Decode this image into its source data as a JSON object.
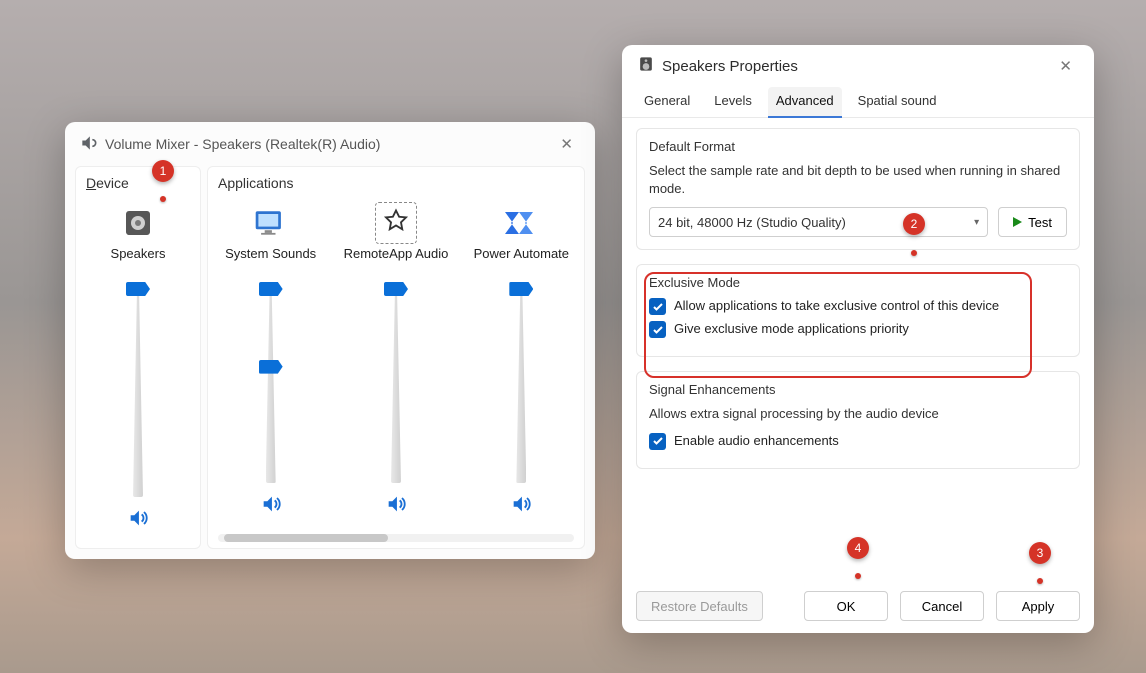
{
  "mixer": {
    "title": "Volume Mixer - Speakers (Realtek(R) Audio)",
    "device_section": "Device",
    "apps_section": "Applications",
    "device": {
      "name": "Speakers",
      "level": 0
    },
    "apps": [
      {
        "name": "System Sounds",
        "level": 40
      },
      {
        "name": "RemoteApp Audio",
        "level": 0
      },
      {
        "name": "Power Automate",
        "level": 0
      }
    ]
  },
  "props": {
    "title": "Speakers Properties",
    "tabs": [
      "General",
      "Levels",
      "Advanced",
      "Spatial sound"
    ],
    "active_tab": 2,
    "default_format": {
      "title": "Default Format",
      "desc": "Select the sample rate and bit depth to be used when running in shared mode.",
      "value": "24 bit, 48000 Hz (Studio Quality)",
      "test": "Test"
    },
    "exclusive": {
      "title": "Exclusive Mode",
      "opt1": "Allow applications to take exclusive control of this device",
      "opt2": "Give exclusive mode applications priority",
      "opt1_checked": true,
      "opt2_checked": true
    },
    "enhance": {
      "title": "Signal Enhancements",
      "desc": "Allows extra signal processing by the audio device",
      "opt": "Enable audio enhancements",
      "checked": true
    },
    "buttons": {
      "restore": "Restore Defaults",
      "ok": "OK",
      "cancel": "Cancel",
      "apply": "Apply"
    }
  },
  "annotations": {
    "n1": "1",
    "n2": "2",
    "n3": "3",
    "n4": "4"
  }
}
